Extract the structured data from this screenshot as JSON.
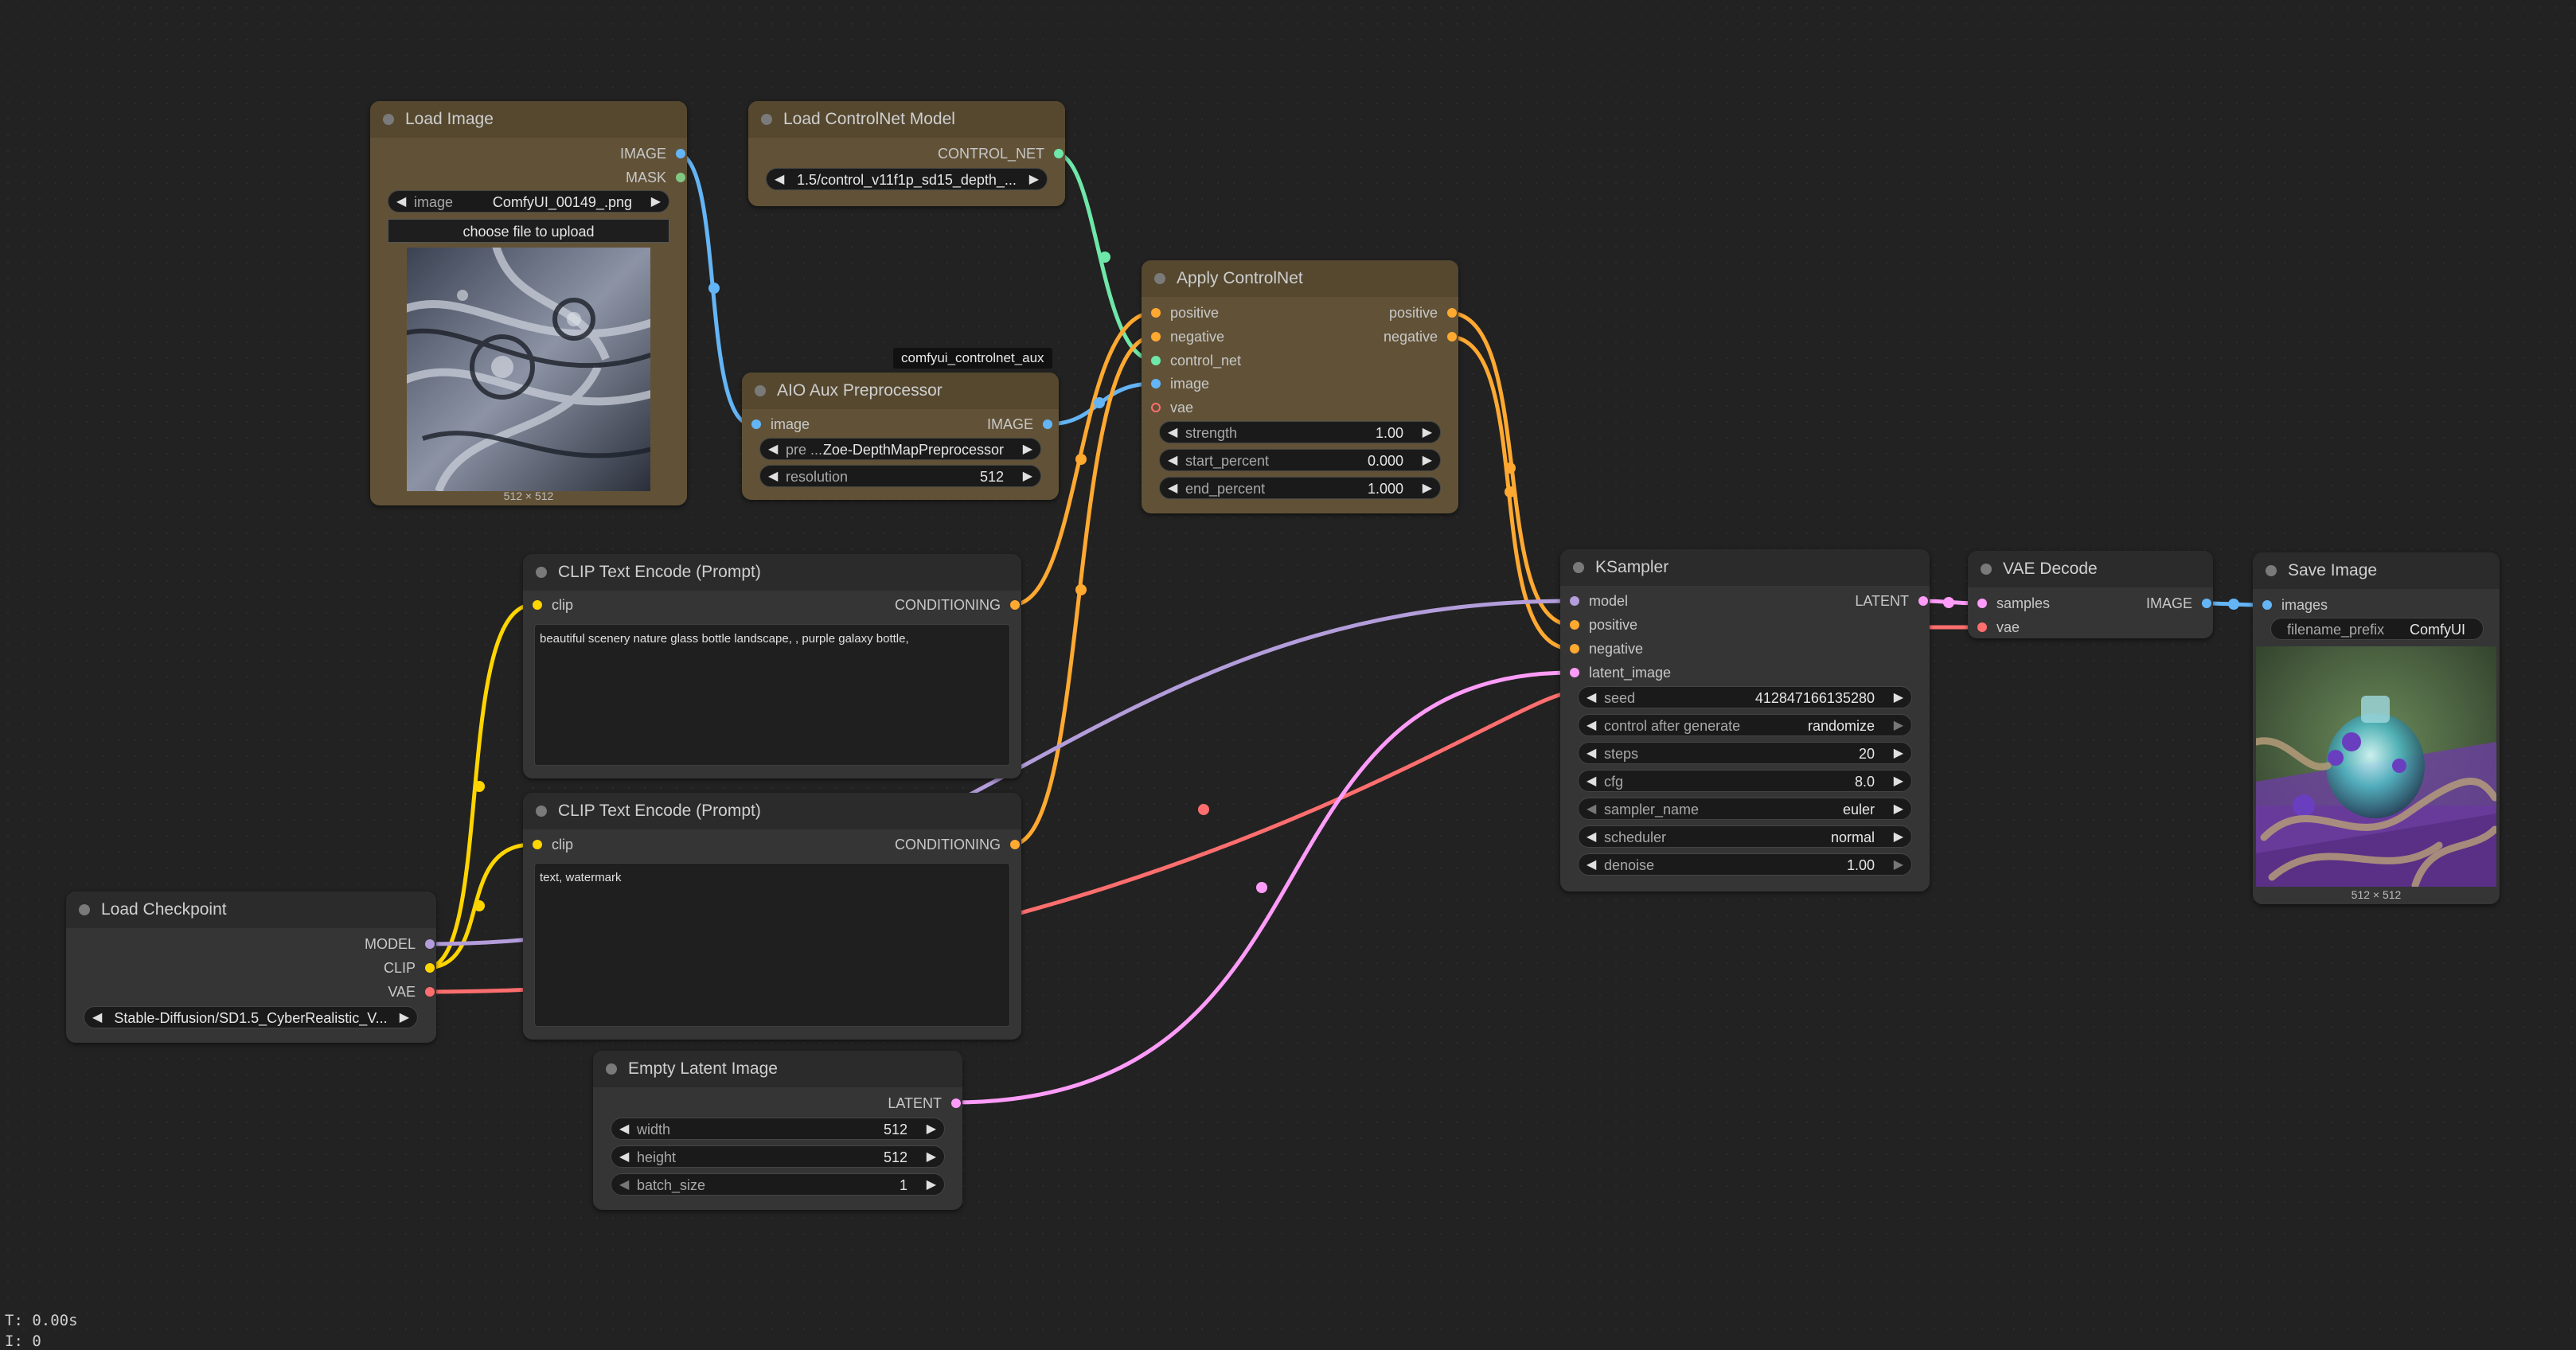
{
  "colors": {
    "image": "#64b5f6",
    "mask": "#81c784",
    "control_net": "#6ee7a8",
    "conditioning": "#ffa931",
    "clip": "#ffd500",
    "model": "#b39ddb",
    "vae": "#ff6e6e",
    "latent": "#ff9cf9"
  },
  "nodes": {
    "load_image": {
      "title": "Load Image",
      "outputs": [
        "IMAGE",
        "MASK"
      ],
      "widget_image": {
        "label": "image",
        "value": "ComfyUI_00149_.png"
      },
      "upload_button": "choose file to upload",
      "caption": "512 × 512"
    },
    "load_controlnet": {
      "title": "Load ControlNet Model",
      "output": "CONTROL_NET",
      "widget_value": "1.5/control_v11f1p_sd15_depth_..."
    },
    "aio_aux": {
      "badge": "comfyui_controlnet_aux",
      "title": "AIO Aux Preprocessor",
      "input": "image",
      "output": "IMAGE",
      "widget_pre": {
        "label": "pre ...",
        "value": "Zoe-DepthMapPreprocessor"
      },
      "widget_res": {
        "label": "resolution",
        "value": "512"
      }
    },
    "apply_controlnet": {
      "title": "Apply ControlNet",
      "inputs": [
        "positive",
        "negative",
        "control_net",
        "image",
        "vae"
      ],
      "outputs": [
        "positive",
        "negative"
      ],
      "widgets": [
        {
          "label": "strength",
          "value": "1.00"
        },
        {
          "label": "start_percent",
          "value": "0.000"
        },
        {
          "label": "end_percent",
          "value": "1.000"
        }
      ]
    },
    "clip_pos": {
      "title": "CLIP Text Encode (Prompt)",
      "input": "clip",
      "output": "CONDITIONING",
      "text": "beautiful scenery nature glass bottle landscape, , purple galaxy bottle,"
    },
    "clip_neg": {
      "title": "CLIP Text Encode (Prompt)",
      "input": "clip",
      "output": "CONDITIONING",
      "text": "text, watermark"
    },
    "load_checkpoint": {
      "title": "Load Checkpoint",
      "outputs": [
        "MODEL",
        "CLIP",
        "VAE"
      ],
      "widget_value": "Stable-Diffusion/SD1.5_CyberRealistic_V..."
    },
    "empty_latent": {
      "title": "Empty Latent Image",
      "output": "LATENT",
      "widgets": [
        {
          "label": "width",
          "value": "512"
        },
        {
          "label": "height",
          "value": "512"
        },
        {
          "label": "batch_size",
          "value": "1"
        }
      ]
    },
    "ksampler": {
      "title": "KSampler",
      "inputs": [
        "model",
        "positive",
        "negative",
        "latent_image"
      ],
      "output": "LATENT",
      "widgets": [
        {
          "label": "seed",
          "value": "412847166135280"
        },
        {
          "label": "control after generate",
          "value": "randomize"
        },
        {
          "label": "steps",
          "value": "20"
        },
        {
          "label": "cfg",
          "value": "8.0"
        },
        {
          "label": "sampler_name",
          "value": "euler"
        },
        {
          "label": "scheduler",
          "value": "normal"
        },
        {
          "label": "denoise",
          "value": "1.00"
        }
      ]
    },
    "vae_decode": {
      "title": "VAE Decode",
      "inputs": [
        "samples",
        "vae"
      ],
      "output": "IMAGE"
    },
    "save_image": {
      "title": "Save Image",
      "input": "images",
      "widget_prefix": {
        "label": "filename_prefix",
        "value": "ComfyUI"
      },
      "caption": "512 × 512"
    }
  },
  "status": {
    "time": "T: 0.00s",
    "line2": "I: 0"
  }
}
